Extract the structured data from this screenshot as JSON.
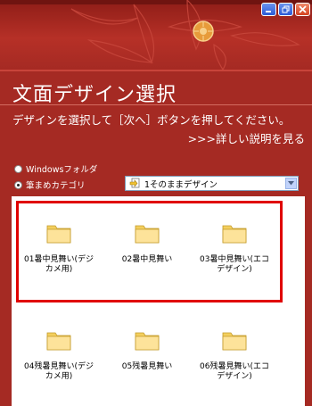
{
  "window": {
    "controls": [
      "minimize",
      "restore",
      "close"
    ]
  },
  "header": {
    "title": "文面デザイン選択",
    "instruction": "デザインを選択して［次へ］ボタンを押してください。",
    "detail_link": ">>>詳しい説明を見る"
  },
  "source": {
    "options": [
      {
        "label": "Windowsフォルダ",
        "checked": false
      },
      {
        "label": "筆まめカテゴリ",
        "checked": true
      }
    ],
    "selected_category": "1そのままデザイン"
  },
  "items": [
    {
      "label_line1": "01暑中見舞い(デジ",
      "label_line2": "カメ用)",
      "selected": true
    },
    {
      "label_line1": "02暑中見舞い",
      "label_line2": "",
      "selected": true
    },
    {
      "label_line1": "03暑中見舞い(エコ",
      "label_line2": "デザイン)",
      "selected": true
    },
    {
      "label_line1": "04残暑見舞い(デジ",
      "label_line2": "カメ用)",
      "selected": false
    },
    {
      "label_line1": "05残暑見舞い",
      "label_line2": "",
      "selected": false
    },
    {
      "label_line1": "06残暑見舞い(エコ",
      "label_line2": "デザイン)",
      "selected": false
    }
  ],
  "colors": {
    "background": "#a52a23",
    "selection_border": "#e00000",
    "folder": "#f7d97a"
  }
}
